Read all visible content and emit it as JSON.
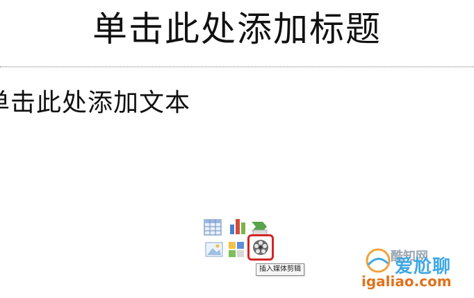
{
  "slide": {
    "title_placeholder": "单击此处添加标题",
    "text_placeholder": "单击此处添加文本"
  },
  "content_icons": {
    "items": [
      {
        "name": "table-icon"
      },
      {
        "name": "chart-icon"
      },
      {
        "name": "smartart-icon"
      },
      {
        "name": "picture-icon"
      },
      {
        "name": "clipart-icon"
      },
      {
        "name": "media-clip-icon"
      }
    ],
    "highlight_color": "#d42426",
    "tooltip": "插入媒体剪辑"
  },
  "watermark": {
    "label": "酷知网",
    "brand": "爱尬聊",
    "url": "igaliao.com"
  }
}
